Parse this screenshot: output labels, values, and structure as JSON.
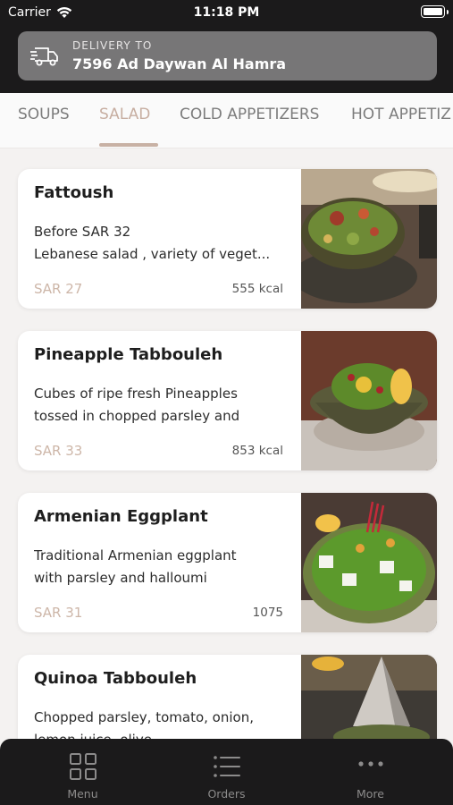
{
  "status_bar": {
    "carrier": "Carrier",
    "time": "11:18 PM"
  },
  "delivery": {
    "label": "DELIVERY TO",
    "address": "7596 Ad Daywan Al Hamra",
    "icon": "truck-icon"
  },
  "tabs": [
    {
      "label": "SOUPS"
    },
    {
      "label": "SALAD",
      "active": true
    },
    {
      "label": "COLD APPETIZERS"
    },
    {
      "label": "HOT APPETIZ"
    }
  ],
  "items": [
    {
      "name": "Fattoush",
      "desc1": "Before SAR 32",
      "desc2": "Lebanese salad , variety of veget...",
      "price": "SAR 27",
      "kcal": "555 kcal"
    },
    {
      "name": "Pineapple Tabbouleh",
      "desc1": "Cubes of ripe fresh Pineapples",
      "desc2": "tossed in chopped parsley and",
      "price": "SAR 33",
      "kcal": "853 kcal"
    },
    {
      "name": "Armenian Eggplant",
      "desc1": "Traditional Armenian eggplant",
      "desc2": "with parsley and halloumi",
      "price": "SAR 31",
      "kcal": "1075"
    },
    {
      "name": "Quinoa Tabbouleh",
      "desc1": "Chopped parsley, tomato, onion,",
      "desc2": "lemon juice, olive",
      "price": "",
      "kcal": ""
    }
  ],
  "bottom_nav": [
    {
      "label": "Menu",
      "icon": "grid-icon"
    },
    {
      "label": "Orders",
      "icon": "list-icon"
    },
    {
      "label": "More",
      "icon": "more-dots-icon"
    }
  ],
  "colors": {
    "accent": "#c8b1a4",
    "header_bg": "#1b1a1b",
    "delivery_bg": "#777677"
  }
}
